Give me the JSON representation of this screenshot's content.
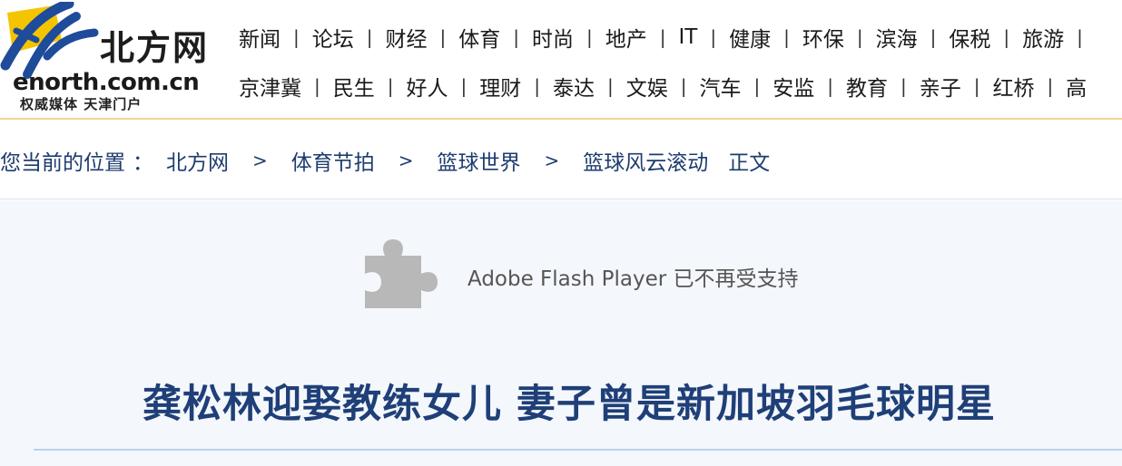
{
  "logo": {
    "name_cn": "北方网",
    "url": "enorth.com.cn",
    "tagline": "权威媒体  天津门户",
    "colors": {
      "brand_blue": "#1e4c9a",
      "brand_yellow": "#f5c400"
    }
  },
  "nav": {
    "row1": [
      "新闻",
      "论坛",
      "财经",
      "体育",
      "时尚",
      "地产",
      "IT",
      "健康",
      "环保",
      "滨海",
      "保税",
      "旅游"
    ],
    "row2": [
      "京津冀",
      "民生",
      "好人",
      "理财",
      "泰达",
      "文娱",
      "汽车",
      "安监",
      "教育",
      "亲子",
      "红桥",
      "高"
    ],
    "separator": "|"
  },
  "breadcrumb": {
    "label": "您当前的位置",
    "colon": "：",
    "items": [
      "北方网",
      "体育节拍",
      "篮球世界",
      "篮球风云滚动"
    ],
    "separator": ">",
    "current": "正文"
  },
  "flash": {
    "icon": "puzzle-icon",
    "message": "Adobe Flash Player 已不再受支持"
  },
  "article": {
    "title": "龚松林迎娶教练女儿  妻子曾是新加坡羽毛球明星"
  }
}
